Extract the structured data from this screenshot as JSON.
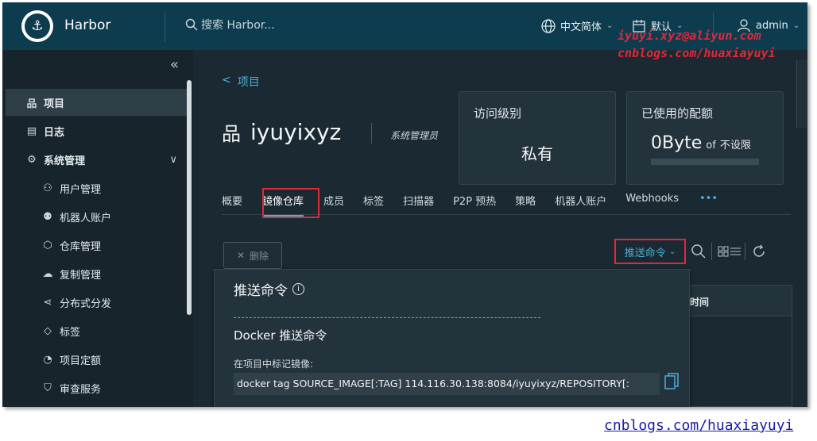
{
  "header": {
    "app_title": "Harbor",
    "search_placeholder": "搜索 Harbor...",
    "language": "中文简体",
    "date_format": "默认",
    "user": "admin"
  },
  "watermark": {
    "line1": "iyuyi.xyz@aliyun.com",
    "line2": "cnblogs.com/huaxiayuyi",
    "footer": "cnblogs.com/huaxiayuyi"
  },
  "sidebar": {
    "items": [
      {
        "label": "项目",
        "icon": "project-icon"
      },
      {
        "label": "日志",
        "icon": "log-icon"
      },
      {
        "label": "系统管理",
        "icon": "admin-icon"
      },
      {
        "label": "用户管理",
        "icon": "users-icon"
      },
      {
        "label": "机器人账户",
        "icon": "robot-icon"
      },
      {
        "label": "仓库管理",
        "icon": "registry-icon"
      },
      {
        "label": "复制管理",
        "icon": "replication-icon"
      },
      {
        "label": "分布式分发",
        "icon": "distribution-icon"
      },
      {
        "label": "标签",
        "icon": "tag-icon"
      },
      {
        "label": "项目定额",
        "icon": "quota-icon"
      },
      {
        "label": "审查服务",
        "icon": "shield-icon"
      }
    ]
  },
  "main": {
    "back_label": "项目",
    "project_name": "iyuyixyz",
    "role": "系统管理员",
    "access_card": {
      "title": "访问级别",
      "value": "私有"
    },
    "quota_card": {
      "title": "已使用的配额",
      "used": "0Byte",
      "of": "of",
      "limit": "不设限"
    },
    "tabs": [
      "概要",
      "镜像仓库",
      "成员",
      "标签",
      "扫描器",
      "P2P 预热",
      "策略",
      "机器人账户",
      "Webhooks",
      "•••"
    ],
    "active_tab": "镜像仓库",
    "delete_label": "删除",
    "push_command_label": "推送命令",
    "table_col_time": "时间"
  },
  "popover": {
    "title": "推送命令",
    "dash_text": "- - - - - - - - - - - - - - - - - - - - - - - - - - - - - - - - - - - - -",
    "docker_title": "Docker 推送命令",
    "tag_label": "在项目中标记镜像:",
    "tag_command": "docker tag SOURCE_IMAGE[:TAG] 114.116.30.138:8084/iyuyixyz/REPOSITORY[:"
  },
  "colors": {
    "header_bg": "#0e3c4f",
    "sidebar_bg": "#17242b",
    "main_bg": "#1b2a32",
    "accent": "#4aaed9",
    "highlight": "#e0283b"
  }
}
